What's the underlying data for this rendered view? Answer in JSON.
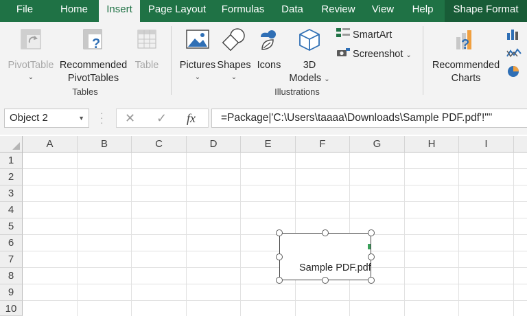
{
  "tabs": [
    {
      "label": "File"
    },
    {
      "label": "Home"
    },
    {
      "label": "Insert"
    },
    {
      "label": "Page Layout"
    },
    {
      "label": "Formulas"
    },
    {
      "label": "Data"
    },
    {
      "label": "Review"
    },
    {
      "label": "View"
    },
    {
      "label": "Help"
    },
    {
      "label": "Shape Format"
    }
  ],
  "ribbon": {
    "tables": {
      "pivottable": "PivotTable",
      "recommended_line1": "Recommended",
      "recommended_line2": "PivotTables",
      "table": "Table",
      "group_label": "Tables"
    },
    "illustrations": {
      "pictures": "Pictures",
      "shapes": "Shapes",
      "icons": "Icons",
      "models_line1": "3D",
      "models_line2": "Models",
      "smartart": "SmartArt",
      "screenshot": "Screenshot",
      "group_label": "Illustrations"
    },
    "charts": {
      "recommended_line1": "Recommended",
      "recommended_line2": "Charts"
    }
  },
  "formula_bar": {
    "name_box": "Object 2",
    "fx": "fx",
    "formula": "=Package|'C:\\Users\\taaaa\\Downloads\\Sample PDF.pdf'!\"\""
  },
  "grid": {
    "columns": [
      "A",
      "B",
      "C",
      "D",
      "E",
      "F",
      "G",
      "H",
      "I"
    ],
    "rows": [
      "1",
      "2",
      "3",
      "4",
      "5",
      "6",
      "7",
      "8",
      "9",
      "10"
    ]
  },
  "object": {
    "label": "Sample PDF.pdf"
  },
  "colors": {
    "excel_green": "#1f7245",
    "shape_format_tab": "#185c37"
  }
}
